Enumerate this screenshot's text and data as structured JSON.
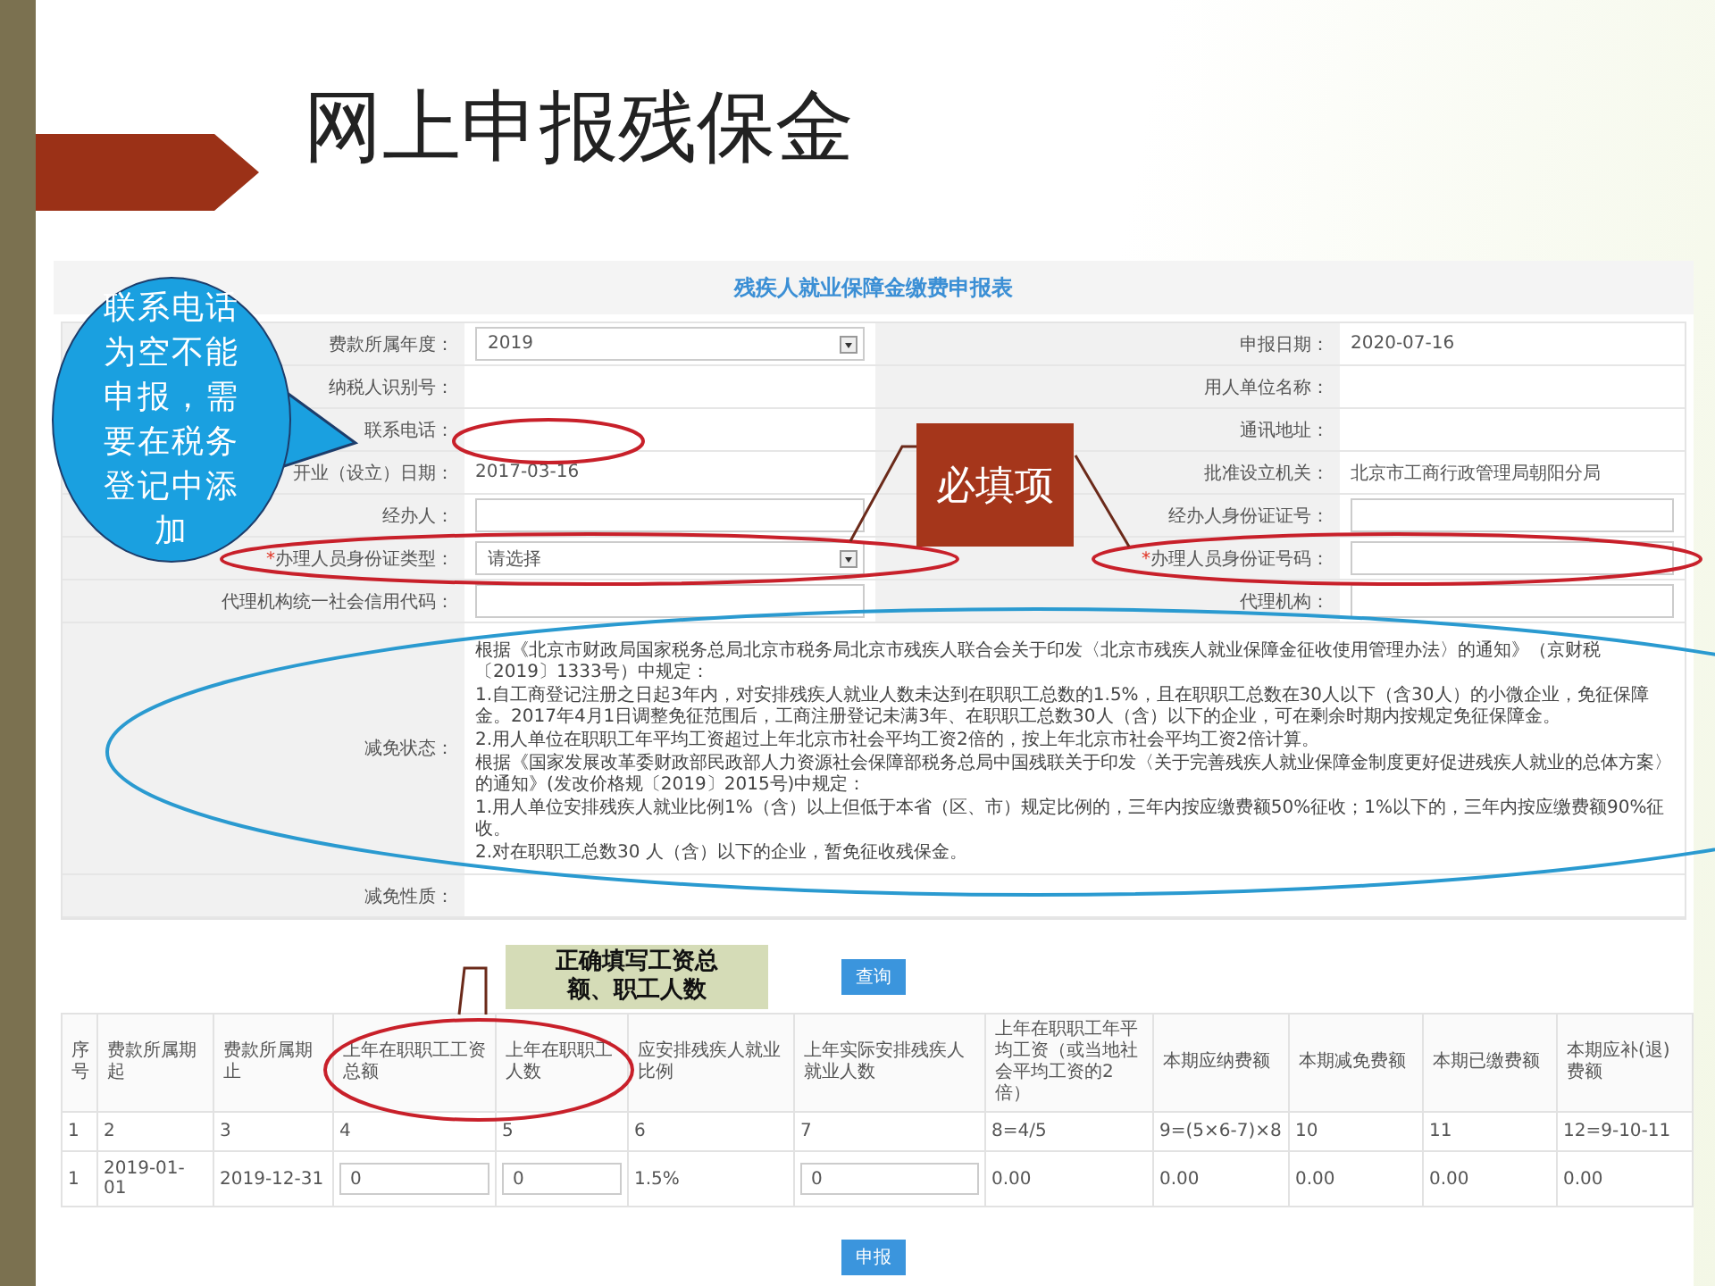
{
  "slide": {
    "title": "网上申报残保金"
  },
  "form": {
    "title": "残疾人就业保障金缴费申报表",
    "fields": [
      {
        "label": "费款所属年度：",
        "kind": "select",
        "value": "2019"
      },
      {
        "label": "申报日期：",
        "kind": "text",
        "value": "2020-07-16"
      },
      {
        "label": "纳税人识别号：",
        "kind": "text"
      },
      {
        "label": "用人单位名称：",
        "kind": "text"
      },
      {
        "label": "联系电话：",
        "kind": "text"
      },
      {
        "label": "通讯地址：",
        "kind": "text"
      },
      {
        "label": "开业（设立）日期：",
        "kind": "text",
        "value": "2017-03-16"
      },
      {
        "label": "批准设立机关：",
        "kind": "text",
        "value": "北京市工商行政管理局朝阳分局"
      },
      {
        "label": "经办人：",
        "kind": "input"
      },
      {
        "label": "经办人身份证证号：",
        "kind": "input"
      },
      {
        "label": "办理人员身份证类型：",
        "required_mark": "*",
        "kind": "select",
        "value": "请选择"
      },
      {
        "label": "办理人员身份证号码：",
        "required_mark": "*",
        "kind": "input"
      },
      {
        "label": "代理机构统一社会信用代码：",
        "kind": "input"
      },
      {
        "label": "代理机构：",
        "kind": "input"
      }
    ],
    "exemption_status": {
      "label": "减免状态：",
      "paragraphs": [
        "根据《北京市财政局国家税务总局北京市税务局北京市残疾人联合会关于印发〈北京市残疾人就业保障金征收使用管理办法〉的通知》（京财税〔2019〕1333号）中规定：",
        "1.自工商登记注册之日起3年内，对安排残疾人就业人数未达到在职职工总数的1.5%，且在职职工总数在30人以下（含30人）的小微企业，免征保障金。2017年4月1日调整免征范围后，工商注册登记未满3年、在职职工总数30人（含）以下的企业，可在剩余时期内按规定免征保障金。",
        "2.用人单位在职职工年平均工资超过上年北京市社会平均工资2倍的，按上年北京市社会平均工资2倍计算。",
        "根据《国家发展改革委财政部民政部人力资源社会保障部税务总局中国残联关于印发〈关于完善残疾人就业保障金制度更好促进残疾人就业的总体方案〉的通知》(发改价格规〔2019〕2015号)中规定：",
        "1.用人单位安排残疾人就业比例1%（含）以上但低于本省（区、市）规定比例的，三年内按应缴费额50%征收；1%以下的，三年内按应缴费额90%征收。",
        "2.对在职职工总数30 人（含）以下的企业，暂免征收残保金。"
      ]
    },
    "exemption_nature": {
      "label": "减免性质："
    }
  },
  "query_button": "查询",
  "table": {
    "columns": [
      "序号",
      "费款所属期起",
      "费款所属期止",
      "上年在职职工工资总额",
      "上年在职职工人数",
      "应安排残疾人就业比例",
      "上年实际安排残疾人就业人数",
      "上年在职职工年平均工资（或当地社会平均工资的2倍）",
      "本期应纳费额",
      "本期减免费额",
      "本期已缴费额",
      "本期应补(退)费额"
    ],
    "rows": [
      {
        "cells": [
          {
            "kind": "text",
            "value": "1"
          },
          {
            "kind": "text",
            "value": "2"
          },
          {
            "kind": "text",
            "value": "3"
          },
          {
            "kind": "text",
            "value": "4"
          },
          {
            "kind": "text",
            "value": "5"
          },
          {
            "kind": "text",
            "value": "6"
          },
          {
            "kind": "text",
            "value": "7"
          },
          {
            "kind": "text",
            "value": "8=4/5"
          },
          {
            "kind": "text",
            "value": "9=(5×6-7)×8"
          },
          {
            "kind": "text",
            "value": "10"
          },
          {
            "kind": "text",
            "value": "11"
          },
          {
            "kind": "text",
            "value": "12=9-10-11"
          }
        ]
      },
      {
        "cells": [
          {
            "kind": "text",
            "value": "1"
          },
          {
            "kind": "text",
            "value": "2019-01-01"
          },
          {
            "kind": "text",
            "value": "2019-12-31"
          },
          {
            "kind": "input",
            "value": "0"
          },
          {
            "kind": "input",
            "value": "0"
          },
          {
            "kind": "text",
            "value": "1.5%"
          },
          {
            "kind": "input",
            "value": "0"
          },
          {
            "kind": "text",
            "value": "0.00"
          },
          {
            "kind": "text",
            "value": "0.00"
          },
          {
            "kind": "text",
            "value": "0.00"
          },
          {
            "kind": "text",
            "value": "0.00"
          },
          {
            "kind": "text",
            "value": "0.00"
          }
        ]
      }
    ]
  },
  "submit_button": "申报",
  "annotations": [
    {
      "kind": "bubble",
      "text": "联系电话为空不能申报，需要在税务登记中添加"
    },
    {
      "kind": "required",
      "text": "必填项"
    },
    {
      "kind": "note",
      "text": "正确填写工资总额、职工人数"
    }
  ]
}
